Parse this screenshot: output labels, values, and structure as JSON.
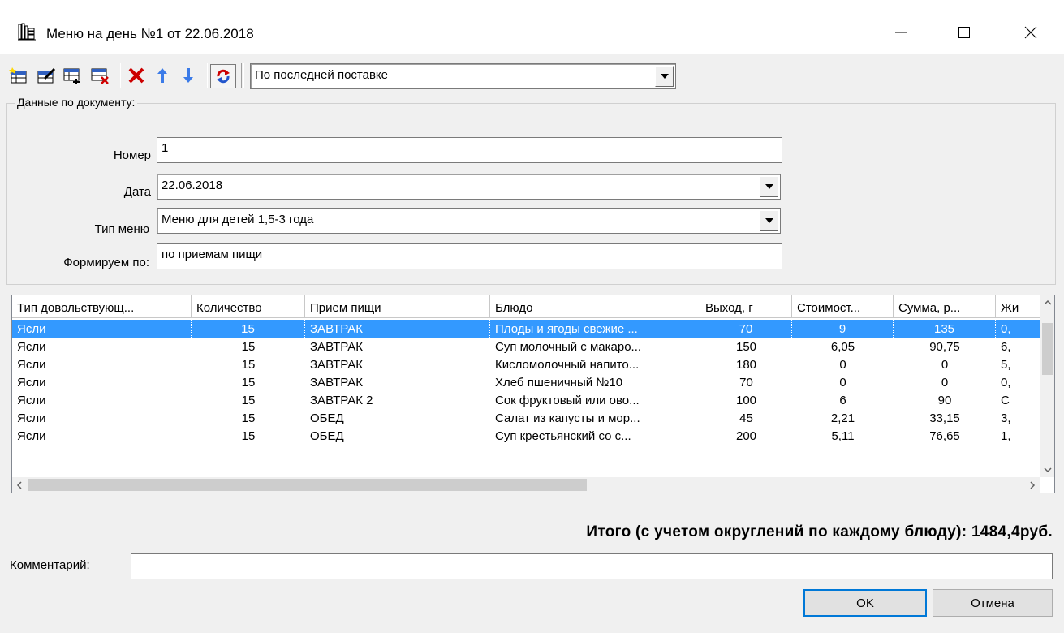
{
  "window": {
    "title": "Меню на день №1 от 22.06.2018",
    "icon": "books-icon",
    "controls": [
      "minimize",
      "maximize",
      "close"
    ]
  },
  "toolbar": {
    "buttons": [
      "add-row-icon",
      "edit-row-icon",
      "insert-row-icon",
      "delete-row-icon",
      "delete-icon",
      "move-up-icon",
      "move-down-icon",
      "refresh-icon"
    ],
    "mode_combo_value": "По последней поставке"
  },
  "document": {
    "legend": "Данные по документу:",
    "number_label": "Номер",
    "number_value": "1",
    "date_label": "Дата",
    "date_value": "22.06.2018",
    "menu_type_label": "Тип меню",
    "menu_type_value": "Меню для детей 1,5-3 года",
    "form_by_label": "Формируем по:",
    "form_by_value": "по приемам пищи"
  },
  "grid": {
    "columns": [
      "Тип довольствующ...",
      "Количество",
      "Прием пищи",
      "Блюдо",
      "Выход, г",
      "Стоимост...",
      "Сумма, р...",
      "Жи"
    ],
    "rows": [
      [
        "Ясли",
        "15",
        "ЗАВТРАК",
        "Плоды и ягоды свежие ...",
        "70",
        "9",
        "135",
        "0,"
      ],
      [
        "Ясли",
        "15",
        "ЗАВТРАК",
        "Суп молочный с макаро...",
        "150",
        "6,05",
        "90,75",
        "6,"
      ],
      [
        "Ясли",
        "15",
        "ЗАВТРАК",
        "Кисломолочный напито...",
        "180",
        "0",
        "0",
        "5,"
      ],
      [
        "Ясли",
        "15",
        "ЗАВТРАК",
        "Хлеб пшеничный №10",
        "70",
        "0",
        "0",
        "0,"
      ],
      [
        "Ясли",
        "15",
        "ЗАВТРАК 2",
        "Сок фруктовый или ово...",
        "100",
        "6",
        "90",
        "С"
      ],
      [
        "Ясли",
        "15",
        "ОБЕД",
        "Салат из капусты и мор...",
        "45",
        "2,21",
        "33,15",
        "3,"
      ],
      [
        "Ясли",
        "15",
        "ОБЕД",
        "Суп крестьянский со с...",
        "200",
        "5,11",
        "76,65",
        "1,"
      ]
    ],
    "selected_row": 0
  },
  "total_text": "Итого (с учетом округлений по каждому блюду): 1484,4руб.",
  "comment": {
    "label": "Комментарий:",
    "value": ""
  },
  "buttons": {
    "ok": "OK",
    "cancel": "Отмена"
  },
  "colors": {
    "selection": "#3399ff",
    "background": "#f0f0f0"
  }
}
